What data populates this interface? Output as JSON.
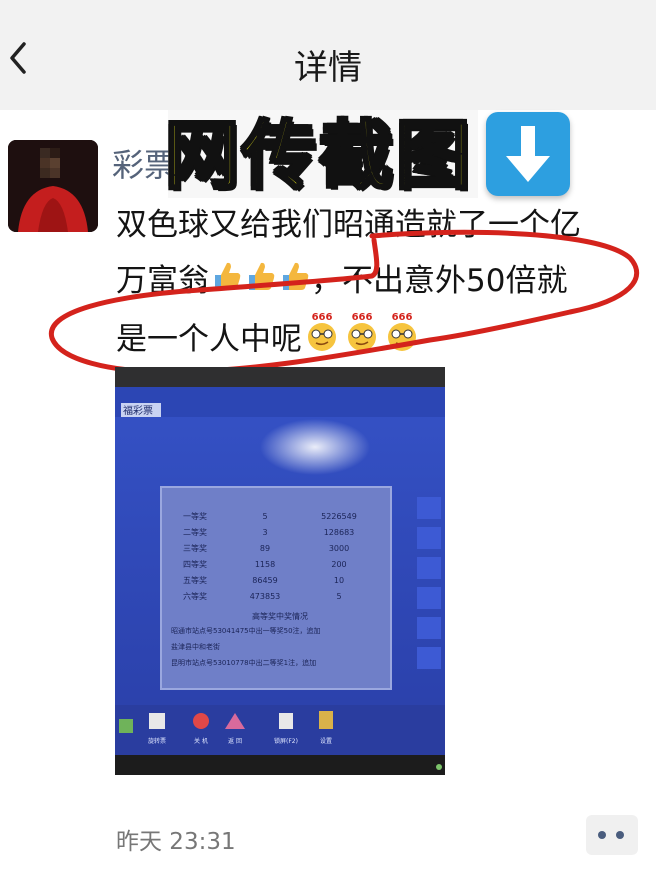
{
  "nav": {
    "title": "详情",
    "back_icon": "chevron-left-icon"
  },
  "post": {
    "author": "彩票",
    "stamp": "网传截图",
    "stamp_icon": "down-arrow-icon",
    "line1": "双色球又给我们昭通造就了一个亿",
    "line2a": "万富翁",
    "line2b": "，",
    "line2c": "不出意外50倍就",
    "line3": "是一个人中呢",
    "thumbs_emoji": "thumbs-up-icon",
    "face_emoji": "666-face-icon",
    "emoji_badge": "666",
    "timestamp": "昨天 23:31",
    "more_icon": "more-dots-icon"
  },
  "screen": {
    "logo": "福彩票",
    "table_rows": [
      [
        "一等奖",
        "5",
        "5226549"
      ],
      [
        "二等奖",
        "3",
        "128683"
      ],
      [
        "三等奖",
        "89",
        "3000"
      ],
      [
        "四等奖",
        "1158",
        "200"
      ],
      [
        "五等奖",
        "86459",
        "10"
      ],
      [
        "六等奖",
        "473853",
        "5"
      ]
    ],
    "section_title": "高等奖中奖情况",
    "notes": [
      "昭通市站点号53041475中出一等奖50注，追加",
      "盐津县中和老街",
      "昆明市站点号53010778中出二等奖1注，追加"
    ],
    "taskbar": [
      "",
      "旋转票",
      "关 机",
      "返 回",
      "锁屏(F2)",
      "设置"
    ]
  },
  "colors": {
    "accent_red": "#d4231c",
    "stamp_yellow": "#f2ef1a",
    "author_blue": "#55637a"
  }
}
